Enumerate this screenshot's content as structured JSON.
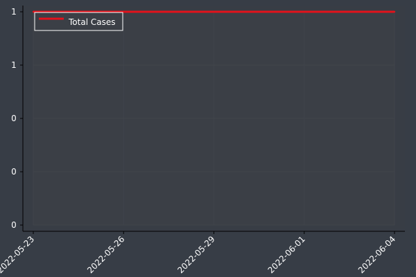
{
  "chart_data": {
    "type": "line",
    "x": [
      "2022-05-23",
      "2022-05-24",
      "2022-05-25",
      "2022-05-26",
      "2022-05-27",
      "2022-05-28",
      "2022-05-29",
      "2022-05-30",
      "2022-05-31",
      "2022-06-01",
      "2022-06-02",
      "2022-06-03",
      "2022-06-04"
    ],
    "series": [
      {
        "name": "Total Cases",
        "values": [
          1,
          1,
          1,
          1,
          1,
          1,
          1,
          1,
          1,
          1,
          1,
          1,
          1
        ],
        "color": "#e3121b"
      }
    ],
    "xticks": [
      "2022-05-23",
      "2022-05-26",
      "2022-05-29",
      "2022-06-01",
      "2022-06-04"
    ],
    "yticks": [
      {
        "value": 0.0,
        "label": "0"
      },
      {
        "value": 0.25,
        "label": "0"
      },
      {
        "value": 0.5,
        "label": "0"
      },
      {
        "value": 0.75,
        "label": "1"
      },
      {
        "value": 1.0,
        "label": "1"
      }
    ],
    "ylim": [
      0,
      1.0
    ],
    "xlim": [
      "2022-05-23",
      "2022-06-04"
    ],
    "legend": {
      "placement": "top-left"
    },
    "grid": true,
    "colors": {
      "background": "#373d46",
      "plot_area": "#3b3f46",
      "axis": "#000000",
      "tick_label": "#ffffff"
    }
  }
}
